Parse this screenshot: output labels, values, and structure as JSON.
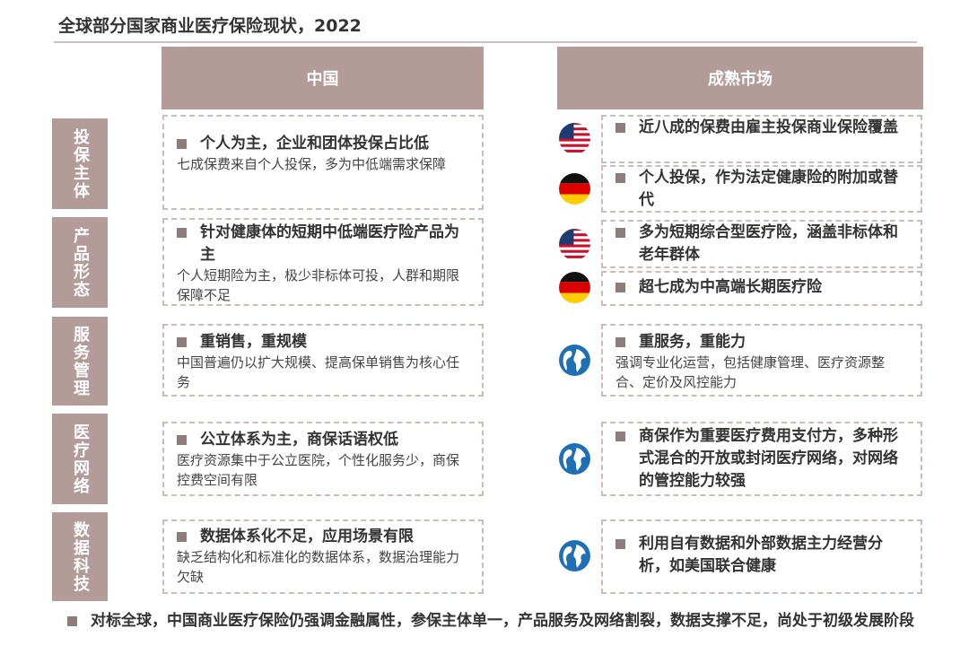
{
  "title": "全球部分国家商业医疗保险现状，2022",
  "columns": {
    "china": "中国",
    "mature": "成熟市场"
  },
  "rows": [
    {
      "label": "投保主体"
    },
    {
      "label": "产品形态"
    },
    {
      "label": "服务管理"
    },
    {
      "label": "医疗网络"
    },
    {
      "label": "数据科技"
    }
  ],
  "china": [
    {
      "head": "个人为主，企业和团体投保占比低",
      "desc": "七成保费来自个人投保，多为中低端需求保障"
    },
    {
      "head": "针对健康体的短期中低端医疗险产品为主",
      "desc": "个人短期险为主，极少非标体可投，人群和期限保障不足"
    },
    {
      "head": "重销售，重规模",
      "desc": "中国普遍仍以扩大规模、提高保单销售为核心任务"
    },
    {
      "head": "公立体系为主，商保话语权低",
      "desc": "医疗资源集中于公立医院，个性化服务少，商保控费空间有限"
    },
    {
      "head": "数据体系化不足，应用场景有限",
      "desc": "缺乏结构化和标准化的数据体系，数据治理能力欠缺"
    }
  ],
  "mature": [
    {
      "head": "近八成的保费由雇主投保商业保险覆盖",
      "icon": "us-flag-icon"
    },
    {
      "head": "个人投保，作为法定健康险的附加或替代",
      "icon": "germany-flag-icon"
    },
    {
      "head": "多为短期综合型医疗险，涵盖非标体和老年群体",
      "icon": "us-flag-icon"
    },
    {
      "head": "超七成为中高端长期医疗险",
      "icon": "germany-flag-icon"
    },
    {
      "head": "重服务，重能力",
      "desc": "强调专业化运营，包括健康管理、医疗资源整合、定价及风控能力",
      "icon": "globe-icon"
    },
    {
      "head": "商保作为重要医疗费用支付方，多种形式混合的开放或封闭医疗网络，对网络的管控能力较强",
      "icon": "globe-icon"
    },
    {
      "head": "利用自有数据和外部数据主力经营分析，如美国联合健康",
      "icon": "globe-icon"
    }
  ],
  "footer": "对标全球，中国商业医疗保险仍强调金融属性，参保主体单一，产品服务及网络割裂，数据支撑不足，尚处于初级发展阶段",
  "colors": {
    "header_bg": "#b39b99",
    "bullet": "#8c7d7c",
    "dash": "#cbbcbb"
  }
}
